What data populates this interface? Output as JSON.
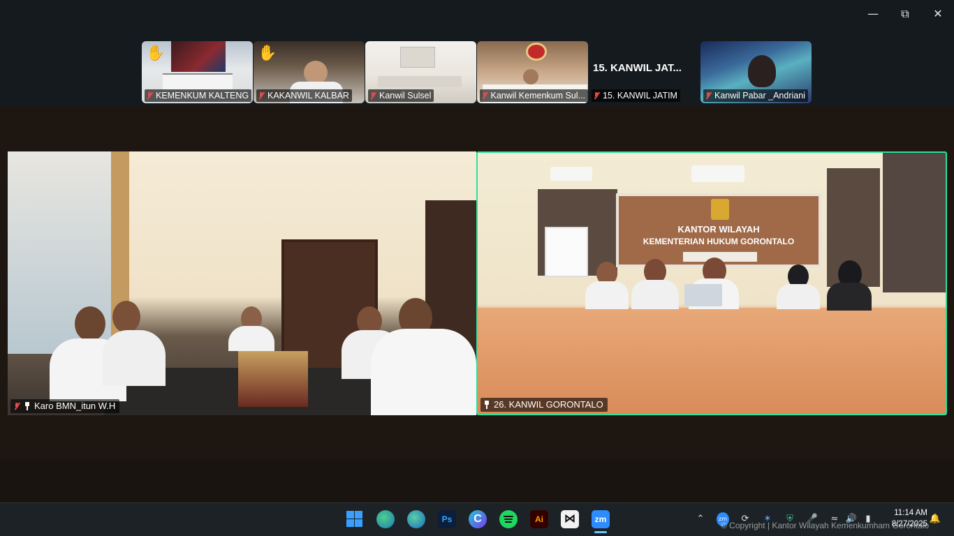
{
  "window": {
    "minimize_icon": "minimize-icon",
    "restore_icon": "restore-icon",
    "close_icon": "close-icon"
  },
  "gallery": [
    {
      "name": "KEMENKUM KALTENG",
      "hand_raised": true,
      "muted": true
    },
    {
      "name": "KAKANWIL KALBAR",
      "hand_raised": true,
      "muted": true
    },
    {
      "name": "Kanwil Sulsel",
      "hand_raised": false,
      "muted": true
    },
    {
      "name": "Kanwil Kemenkum Sul...",
      "hand_raised": false,
      "muted": true
    },
    {
      "name": "15. KANWIL JATIM",
      "hand_raised": false,
      "muted": true,
      "video_off_label": "15. KANWIL JAT..."
    },
    {
      "name": "Kanwil Pabar _Andriani",
      "hand_raised": false,
      "muted": true
    }
  ],
  "main_tiles": [
    {
      "name": "Karo BMN_itun W.H",
      "muted": true,
      "pinned": true
    },
    {
      "name": "26. KANWIL GORONTALO",
      "muted": false,
      "pinned": true,
      "active_speaker": true
    }
  ],
  "scene_text": {
    "sign_line1": "KANTOR WILAYAH",
    "sign_line2": "KEMENTERIAN HUKUM GORONTALO"
  },
  "taskbar": {
    "apps": [
      {
        "name": "windows-start-icon",
        "label": ""
      },
      {
        "name": "edge-beta-icon",
        "label": ""
      },
      {
        "name": "edge-icon",
        "label": ""
      },
      {
        "name": "photoshop-icon",
        "label": "Ps"
      },
      {
        "name": "canva-icon",
        "label": "C"
      },
      {
        "name": "spotify-icon",
        "label": ""
      },
      {
        "name": "illustrator-icon",
        "label": "Ai"
      },
      {
        "name": "capcut-icon",
        "label": ""
      },
      {
        "name": "zoom-icon",
        "label": "zm"
      }
    ],
    "tray": [
      "chevron-up-icon",
      "zoom-tray-icon",
      "sync-icon",
      "bluetooth-icon",
      "defender-icon",
      "microphone-icon",
      "wifi-icon",
      "volume-icon",
      "battery-icon"
    ],
    "time": "11:14 AM",
    "date": "8/27/2025",
    "notification_icon": "notification-icon"
  },
  "watermark": "© Copyright | Kantor Wilayah Kemenkumham Gorontalo",
  "colors": {
    "active_speaker_border": "#2ee09a",
    "mute_red": "#e34b4b"
  }
}
